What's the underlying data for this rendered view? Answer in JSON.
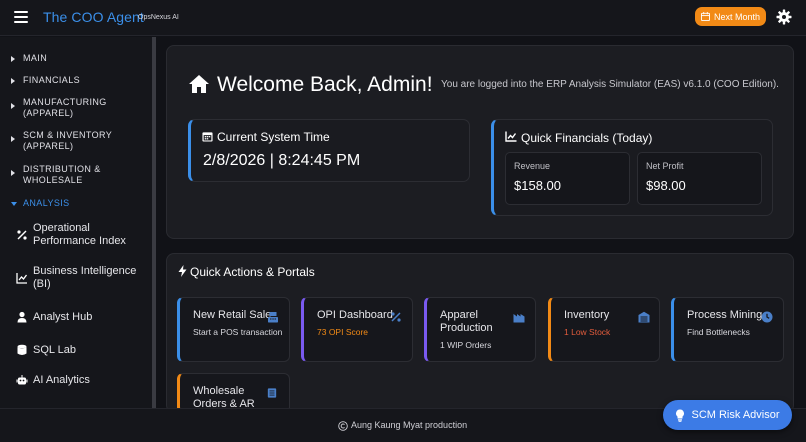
{
  "header": {
    "brand": "The COO Agent",
    "brand_sub": "OpsNexus AI",
    "next_month_label": "Next Month"
  },
  "sidebar": {
    "sections": [
      {
        "label": "MAIN"
      },
      {
        "label": "FINANCIALS"
      },
      {
        "label": "MANUFACTURING (APPAREL)"
      },
      {
        "label": "SCM & INVENTORY (APPAREL)"
      },
      {
        "label": "DISTRIBUTION & WHOLESALE"
      },
      {
        "label": "ANALYSIS"
      }
    ],
    "items": [
      {
        "label": "Operational Performance Index",
        "icon": "percent-icon"
      },
      {
        "label": "Business Intelligence (BI)",
        "icon": "chart-line-icon"
      },
      {
        "label": "Analyst Hub",
        "icon": "user-icon"
      },
      {
        "label": "SQL Lab",
        "icon": "database-icon"
      },
      {
        "label": "AI Analytics",
        "icon": "robot-icon"
      }
    ]
  },
  "welcome": {
    "title": "Welcome Back, Admin!",
    "subtitle": "You are logged into the ERP Analysis Simulator (EAS) v6.1.0 (COO Edition)."
  },
  "system_time": {
    "title": "Current System Time",
    "value": "2/8/2026 | 8:24:45 PM"
  },
  "financials": {
    "title": "Quick Financials (Today)",
    "revenue_label": "Revenue",
    "revenue_value": "$158.00",
    "profit_label": "Net Profit",
    "profit_value": "$98.00"
  },
  "quick_actions": {
    "title": "Quick Actions & Portals",
    "tiles": [
      {
        "name": "New Retail Sale",
        "sub": "Start a POS transaction",
        "accent": "#3b8fe9",
        "sub_color": "#d8d8de",
        "icon": "cash-register-icon"
      },
      {
        "name": "OPI Dashboard",
        "sub": "73 OPI Score",
        "accent": "#7a5af0",
        "sub_color": "#f28a16",
        "icon": "percent-icon"
      },
      {
        "name": "Apparel Production",
        "sub": "1 WIP Orders",
        "accent": "#7a5af0",
        "sub_color": "#d8d8de",
        "icon": "factory-icon"
      },
      {
        "name": "Inventory",
        "sub": "1 Low Stock",
        "accent": "#f28a16",
        "sub_color": "#e25c3c",
        "icon": "warehouse-icon"
      },
      {
        "name": "Process Mining",
        "sub": "Find Bottlenecks",
        "accent": "#3b8fe9",
        "sub_color": "#d8d8de",
        "icon": "clock-icon"
      },
      {
        "name": "Wholesale Orders & AR",
        "sub": "",
        "accent": "#f28a16",
        "sub_color": "#d8d8de",
        "icon": "file-icon"
      }
    ]
  },
  "footer": {
    "text": "Aung Kaung Myat production"
  },
  "scm_advisor": {
    "label": "SCM Risk Advisor"
  },
  "colors": {
    "accent": "#3b8fe9",
    "orange": "#f28a16",
    "purple": "#7a5af0",
    "background": "#111217"
  }
}
